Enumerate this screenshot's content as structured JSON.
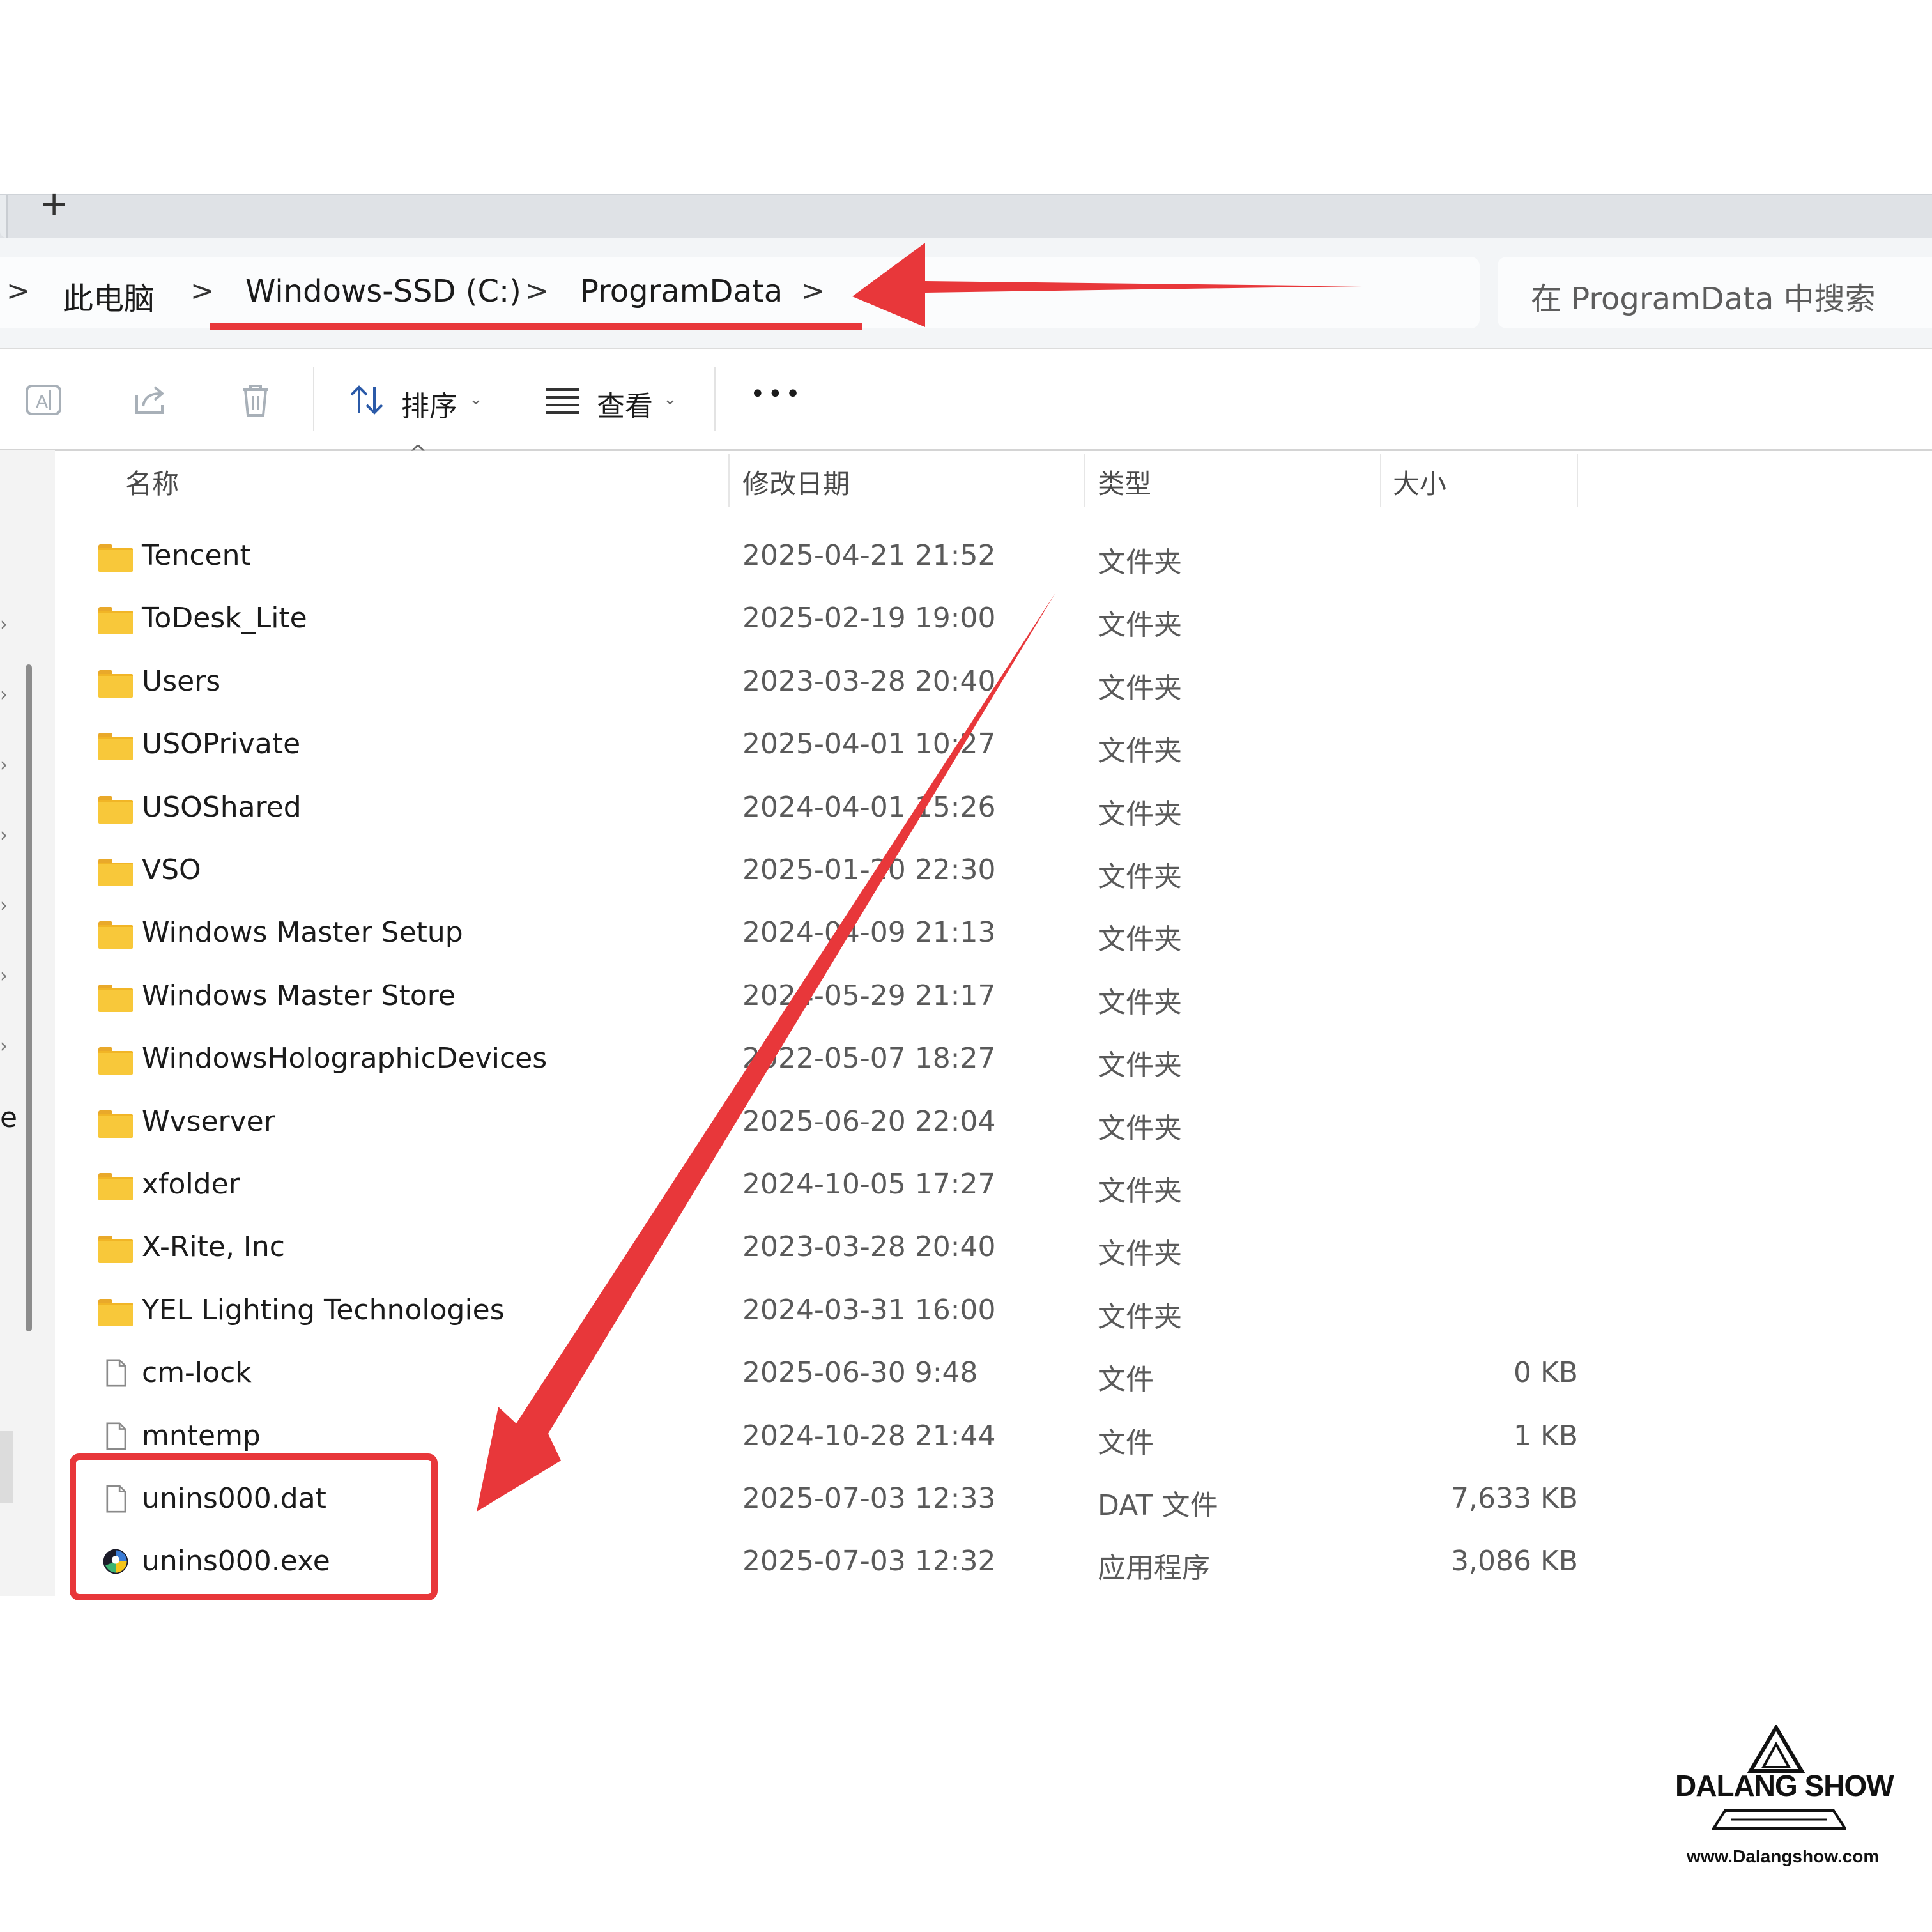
{
  "tabstrip": {
    "new_tab_glyph": "+"
  },
  "breadcrumb": {
    "items": [
      "此电脑",
      "Windows-SSD (C:)",
      "ProgramData"
    ],
    "separator": ">"
  },
  "search": {
    "placeholder": "在 ProgramData 中搜索"
  },
  "toolbar": {
    "sort_label": "排序",
    "view_label": "查看",
    "more_label": "•••",
    "icons": [
      "rename-icon",
      "share-icon",
      "delete-icon",
      "sort-icon",
      "view-icon",
      "more-icon"
    ]
  },
  "columns": {
    "name": "名称",
    "date": "修改日期",
    "type": "类型",
    "size": "大小",
    "sort_indicator": "^"
  },
  "files": [
    {
      "name": "Tencent",
      "date": "2025-04-21 21:52",
      "type": "文件夹",
      "size": "",
      "kind": "folder"
    },
    {
      "name": "ToDesk_Lite",
      "date": "2025-02-19 19:00",
      "type": "文件夹",
      "size": "",
      "kind": "folder"
    },
    {
      "name": "Users",
      "date": "2023-03-28 20:40",
      "type": "文件夹",
      "size": "",
      "kind": "folder"
    },
    {
      "name": "USOPrivate",
      "date": "2025-04-01 10:27",
      "type": "文件夹",
      "size": "",
      "kind": "folder"
    },
    {
      "name": "USOShared",
      "date": "2024-04-01 15:26",
      "type": "文件夹",
      "size": "",
      "kind": "folder"
    },
    {
      "name": "VSO",
      "date": "2025-01-20 22:30",
      "type": "文件夹",
      "size": "",
      "kind": "folder"
    },
    {
      "name": "Windows Master Setup",
      "date": "2024-04-09 21:13",
      "type": "文件夹",
      "size": "",
      "kind": "folder"
    },
    {
      "name": "Windows Master Store",
      "date": "2024-05-29 21:17",
      "type": "文件夹",
      "size": "",
      "kind": "folder"
    },
    {
      "name": "WindowsHolographicDevices",
      "date": "2022-05-07 18:27",
      "type": "文件夹",
      "size": "",
      "kind": "folder"
    },
    {
      "name": "Wvserver",
      "date": "2025-06-20 22:04",
      "type": "文件夹",
      "size": "",
      "kind": "folder"
    },
    {
      "name": "xfolder",
      "date": "2024-10-05 17:27",
      "type": "文件夹",
      "size": "",
      "kind": "folder"
    },
    {
      "name": "X-Rite, Inc",
      "date": "2023-03-28 20:40",
      "type": "文件夹",
      "size": "",
      "kind": "folder"
    },
    {
      "name": "YEL Lighting Technologies",
      "date": "2024-03-31 16:00",
      "type": "文件夹",
      "size": "",
      "kind": "folder"
    },
    {
      "name": "cm-lock",
      "date": "2025-06-30 9:48",
      "type": "文件",
      "size": "0 KB",
      "kind": "file"
    },
    {
      "name": "mntemp",
      "date": "2024-10-28 21:44",
      "type": "文件",
      "size": "1 KB",
      "kind": "file"
    },
    {
      "name": "unins000.dat",
      "date": "2025-07-03 12:33",
      "type": "DAT 文件",
      "size": "7,633 KB",
      "kind": "file"
    },
    {
      "name": "unins000.exe",
      "date": "2025-07-03 12:32",
      "type": "应用程序",
      "size": "3,086 KB",
      "kind": "app"
    }
  ],
  "nav_partial_text": "e",
  "annotation": {
    "color": "#e8373a"
  },
  "watermark": {
    "brand": "DALANG SHOW",
    "url": "www.Dalangshow.com"
  }
}
